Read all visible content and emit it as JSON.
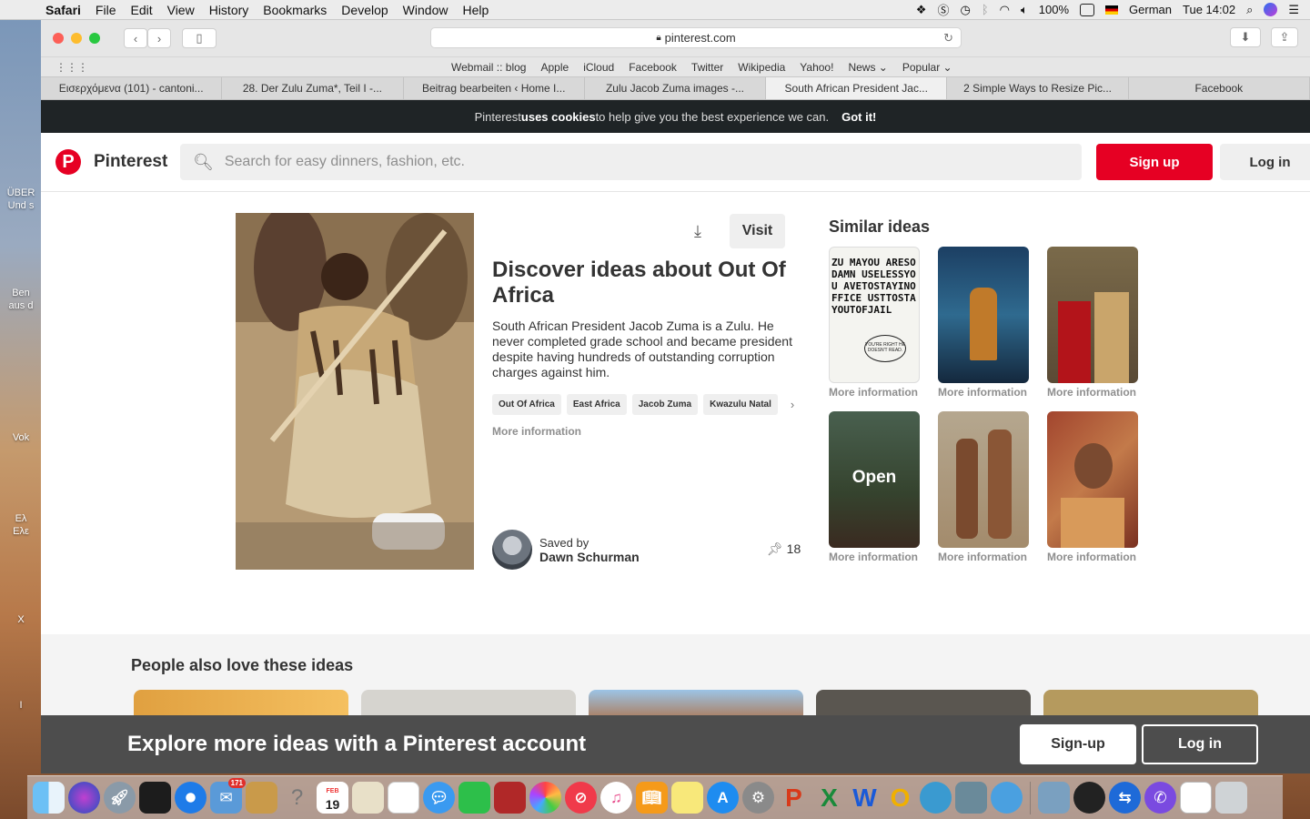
{
  "menubar": {
    "app": "Safari",
    "items": [
      "File",
      "Edit",
      "View",
      "History",
      "Bookmarks",
      "Develop",
      "Window",
      "Help"
    ],
    "battery": "100%",
    "input_source": "German",
    "clock": "Tue 14:02"
  },
  "desktop": {
    "labels": [
      "ÜBER",
      "Und s",
      "Ben",
      "aus d",
      "Vok",
      "Ελ",
      "Ελε",
      "X",
      "I"
    ]
  },
  "browser": {
    "url": "pinterest.com",
    "favorites": [
      "Webmail :: blog",
      "Apple",
      "iCloud",
      "Facebook",
      "Twitter",
      "Wikipedia",
      "Yahoo!",
      "News ⌄",
      "Popular ⌄"
    ],
    "tabs": [
      {
        "label": "Εισερχόμενα (101) - cantoni...",
        "active": false
      },
      {
        "label": "28. Der Zulu Zuma*, Teil I -...",
        "active": false
      },
      {
        "label": "Beitrag bearbeiten ‹ Home I...",
        "active": false
      },
      {
        "label": "Zulu Jacob Zuma images -...",
        "active": false
      },
      {
        "label": "South African President Jac...",
        "active": true
      },
      {
        "label": "2 Simple Ways to Resize Pic...",
        "active": false
      },
      {
        "label": "Facebook",
        "active": false
      }
    ]
  },
  "cookie": {
    "prefix": "Pinterest ",
    "bold": "uses cookies",
    "suffix": " to help give you the best experience we can.",
    "button": "Got it!"
  },
  "header": {
    "logo_letter": "P",
    "brand": "Pinterest",
    "search_placeholder": "Search for easy dinners, fashion, etc.",
    "signup": "Sign up",
    "login": "Log in"
  },
  "pin": {
    "visit": "Visit",
    "title": "Discover ideas about Out Of Africa",
    "description": "South African President Jacob Zuma is a Zulu. He never completed grade school and became president despite having hundreds of outstanding corruption charges against him.",
    "tags": [
      "Out Of Africa",
      "East Africa",
      "Jacob Zuma",
      "Kwazulu Natal"
    ],
    "more": "More information",
    "saved_by_label": "Saved by",
    "saved_by": "Dawn Schurman",
    "saves": "18"
  },
  "similar": {
    "title": "Similar ideas",
    "items": [
      {
        "caption": "More information",
        "image_text": "ZU MAYOU ARESODAMN USELESSYOU AVETOSTAYINOFFICE USTTOSTAYOUTOFJAIL",
        "bubble": "YOU'RE RIGHT HE DOESN'T READ."
      },
      {
        "caption": "More information"
      },
      {
        "caption": "More information"
      },
      {
        "caption": "More information",
        "overlay": "Open"
      },
      {
        "caption": "More information"
      },
      {
        "caption": "More information"
      }
    ]
  },
  "also": {
    "title": "People also love these ideas"
  },
  "bottom": {
    "text": "Explore more ideas with a Pinterest account",
    "signup": "Sign-up",
    "login": "Log in"
  },
  "dock": {
    "calendar_month": "FEB",
    "calendar_day": "19",
    "mail_badge": "171"
  },
  "colors": {
    "pinterest_red": "#e60023",
    "cookie_bar": "#1f2426",
    "bottom_bar": "#4d4d4d"
  }
}
